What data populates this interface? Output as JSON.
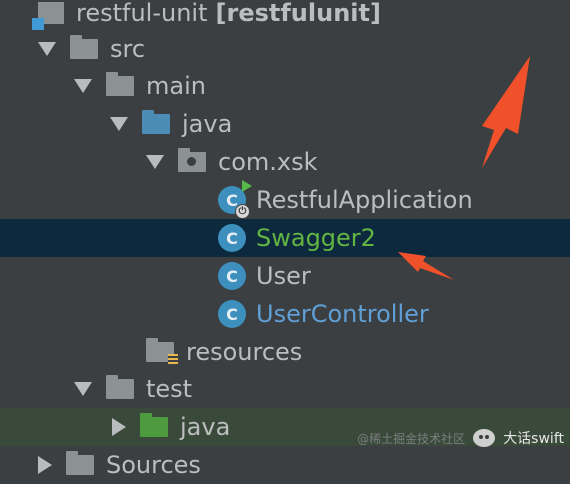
{
  "tree": {
    "root": {
      "name": "restful-unit",
      "module": "[restfulunit]"
    },
    "src": "src",
    "main": "main",
    "java_main": "java",
    "package": "com.xsk",
    "classes": [
      {
        "name": "RestfulApplication",
        "style": "default"
      },
      {
        "name": "Swagger2",
        "style": "green"
      },
      {
        "name": "User",
        "style": "default"
      },
      {
        "name": "UserController",
        "style": "blue"
      }
    ],
    "class_icon_letter": "C",
    "resources": "resources",
    "test": "test",
    "java_test": "java",
    "partial_bottom": "Sources"
  },
  "watermark": {
    "faint_text": "@稀土掘金技术社区",
    "brand": "大话swift"
  },
  "colors": {
    "background": "#3c3f41",
    "selected_row": "#0d293e",
    "annotation_arrow": "#f0502a"
  },
  "icons": [
    "module-icon",
    "folder-icon",
    "package-icon",
    "class-icon",
    "run-badge-icon",
    "resources-folder-icon",
    "test-folder-icon"
  ]
}
